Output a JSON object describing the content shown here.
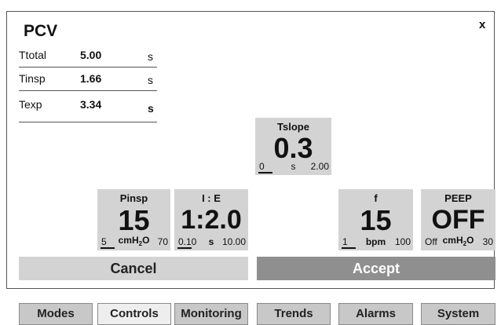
{
  "mode_title": "PCV",
  "close_label": "x",
  "timing": [
    {
      "label": "Ttotal",
      "value": "5.00",
      "unit": "s"
    },
    {
      "label": "Tinsp",
      "value": "1.66",
      "unit": "s"
    },
    {
      "label": "Texp",
      "value": "3.34",
      "unit": "s"
    }
  ],
  "params": {
    "tslope": {
      "name": "Tslope",
      "value": "0.3",
      "min": "0",
      "unit": "s",
      "max": "2.00"
    },
    "pinsp": {
      "name": "Pinsp",
      "value": "15",
      "min": "5",
      "unit_prefix": "cmH",
      "unit_sub": "2",
      "unit_suffix": "O",
      "max": "70"
    },
    "ie": {
      "name": "I : E",
      "value": "1:2.0",
      "min": "0.10",
      "unit": "s",
      "max": "10.00"
    },
    "f": {
      "name": "f",
      "value": "15",
      "min": "1",
      "unit": "bpm",
      "max": "100"
    },
    "peep": {
      "name": "PEEP",
      "value": "OFF",
      "min": "Off",
      "unit_prefix": "cmH",
      "unit_sub": "2",
      "unit_suffix": "O",
      "max": "30"
    }
  },
  "buttons": {
    "cancel": "Cancel",
    "accept": "Accept"
  },
  "tabs": [
    "Modes",
    "Controls",
    "Monitoring",
    "Trends",
    "Alarms",
    "System"
  ],
  "active_tab": "Controls"
}
